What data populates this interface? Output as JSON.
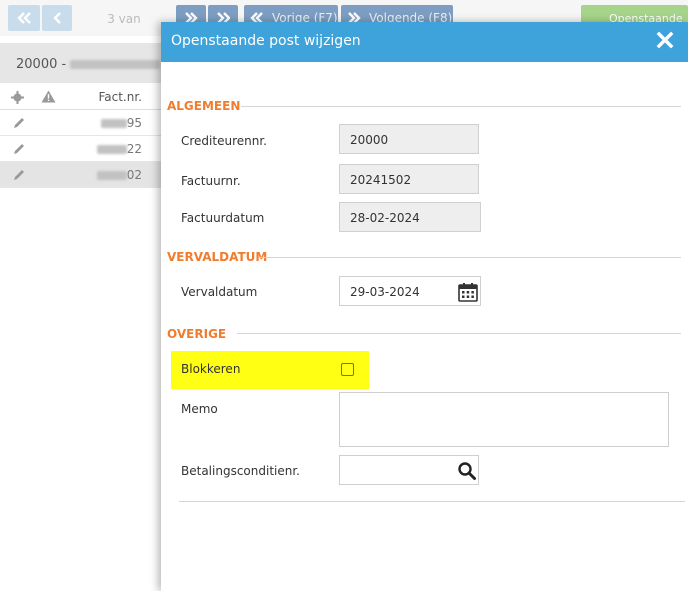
{
  "background": {
    "toolbar": {
      "first_icon": "double-chevron-left-icon",
      "prev_icon": "chevron-left-icon",
      "page_info": "3 van",
      "next_icon": "chevron-right-icon",
      "last_icon": "double-chevron-right-icon",
      "previous_label": "Vorige (F7)",
      "next_label": "Volgende (F8)",
      "open_items_label": "Openstaande"
    },
    "header_title": "20000 -",
    "table": {
      "column_header": "Fact.nr.",
      "header_icons": [
        "gear-icon",
        "warning-icon"
      ],
      "rows": [
        {
          "invoice_suffix": "95",
          "selected": false
        },
        {
          "invoice_suffix": "22",
          "selected": false
        },
        {
          "invoice_suffix": "02",
          "selected": true
        }
      ]
    }
  },
  "modal": {
    "title": "Openstaande post wijzigen",
    "close_icon": "close-icon",
    "sections": {
      "general": "ALGEMEEN",
      "due_date": "VERVALDATUM",
      "other": "OVERIGE"
    },
    "fields": {
      "creditor_label": "Crediteurennr.",
      "creditor_value": "20000",
      "invoice_label": "Factuurnr.",
      "invoice_value": "20241502",
      "invoice_date_label": "Factuurdatum",
      "invoice_date_value": "28-02-2024",
      "due_date_label": "Vervaldatum",
      "due_date_value": "29-03-2024",
      "block_label": "Blokkeren",
      "block_checked": false,
      "memo_label": "Memo",
      "memo_value": "",
      "payment_condition_label": "Betalingsconditienr.",
      "payment_condition_value": ""
    },
    "colors": {
      "header": "#3ea2db",
      "section_title": "#f07c2e",
      "highlight": "#ffff14"
    }
  }
}
